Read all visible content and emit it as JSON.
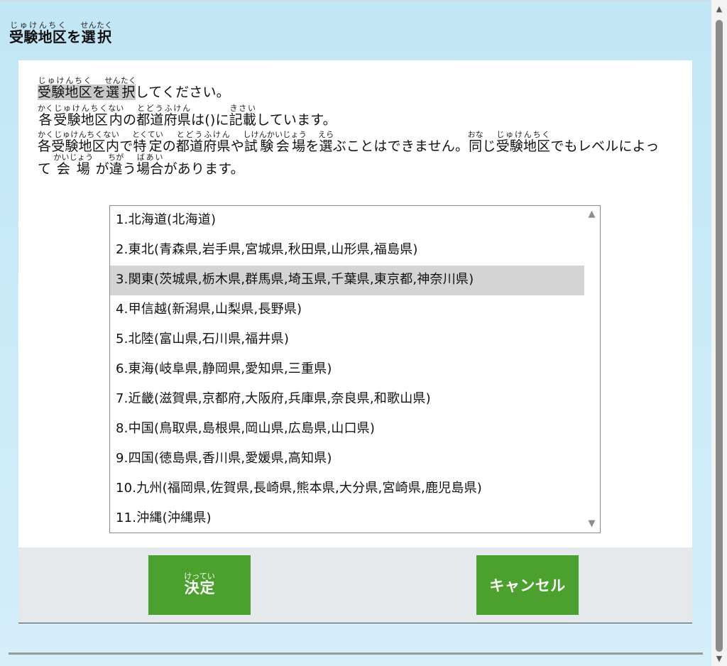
{
  "header": {
    "title_part1": "受験地区",
    "title_part1_ruby": "じゅけんちく",
    "title_part2": "を",
    "title_part3": "選択",
    "title_part3_ruby": "せんたく"
  },
  "instructions": {
    "line1": {
      "w1": "受験地区",
      "w1_ruby": "じゅけんちく",
      "t1": "を",
      "w2": "選択",
      "w2_ruby": "せんたく",
      "t2": "してください。"
    },
    "line2": {
      "w1": "各",
      "w1_ruby": "かく",
      "w2": "受験地区",
      "w2_ruby": "じゅけんちく",
      "w3": "内",
      "w3_ruby": "ない",
      "t1": "の",
      "w4": "都道府県",
      "w4_ruby": "とどうふけん",
      "t2": "は()に",
      "w5": "記載",
      "w5_ruby": "きさい",
      "t3": "しています。"
    },
    "line3": {
      "w1": "各受験地区内",
      "w1_ruby": "かくじゅけんちくない",
      "t1": "で",
      "w2": "特定",
      "w2_ruby": "とくてい",
      "t2": "の",
      "w3": "都道府県",
      "w3_ruby": "とどうふけん",
      "t3": "や",
      "w4": "試験会場",
      "w4_ruby": "しけんかいじょう",
      "t4": "を",
      "w5": "選",
      "w5_ruby": "えら",
      "t5": "ぶことはできません。",
      "w6": "同",
      "w6_ruby": "おな",
      "t6": "じ",
      "w7": "受験地区",
      "w7_ruby": "じゅけんちく",
      "t7": "でもレベルによって",
      "w8": "会場",
      "w8_ruby": "かいじょう",
      "t8": "が",
      "w9": "違",
      "w9_ruby": "ちが",
      "t9": "う",
      "w10": "場合",
      "w10_ruby": "ばあい",
      "t10": "があります。"
    }
  },
  "regions": [
    "1.北海道(北海道)",
    "2.東北(青森県,岩手県,宮城県,秋田県,山形県,福島県)",
    "3.関東(茨城県,栃木県,群馬県,埼玉県,千葉県,東京都,神奈川県)",
    "4.甲信越(新潟県,山梨県,長野県)",
    "5.北陸(富山県,石川県,福井県)",
    "6.東海(岐阜県,静岡県,愛知県,三重県)",
    "7.近畿(滋賀県,京都府,大阪府,兵庫県,奈良県,和歌山県)",
    "8.中国(鳥取県,島根県,岡山県,広島県,山口県)",
    "9.四国(徳島県,香川県,愛媛県,高知県)",
    "10.九州(福岡県,佐賀県,長崎県,熊本県,大分県,宮崎県,鹿児島県)",
    "11.沖縄(沖縄県)"
  ],
  "selected_index": 2,
  "buttons": {
    "ok_label": "決定",
    "ok_ruby": "けってい",
    "cancel_label": "キャンセル"
  },
  "icons": {
    "list_scroll_up": "triangle-up-icon",
    "list_scroll_down": "triangle-down-icon",
    "page_scroll_up": "triangle-up-icon",
    "page_scroll_down": "triangle-down-icon"
  },
  "colors": {
    "background": "#c2e6f6",
    "button": "#4ca02e",
    "selected_row": "#d4d4d4"
  }
}
